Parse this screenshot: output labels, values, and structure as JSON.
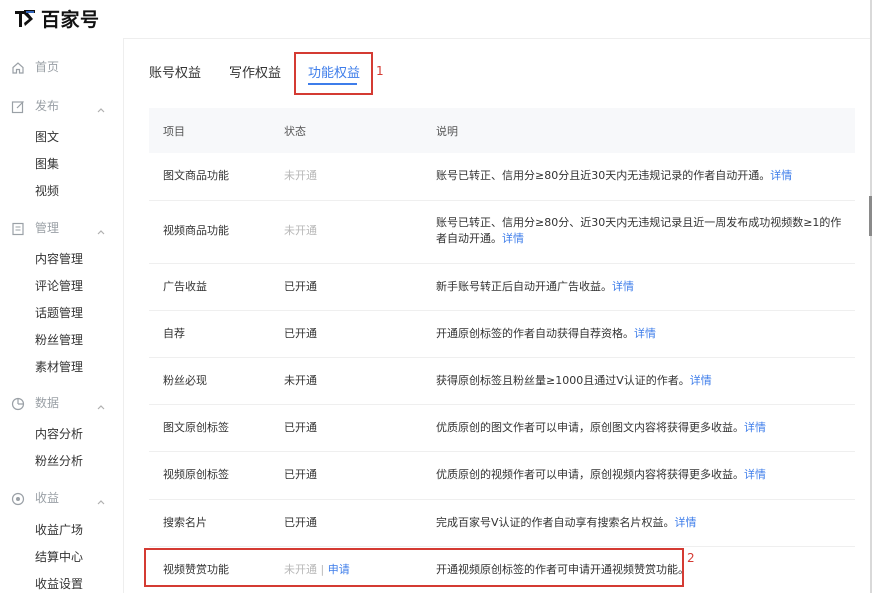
{
  "brand": {
    "name": "百家号"
  },
  "sidebar": {
    "home": "首页",
    "sections": [
      {
        "label": "发布",
        "items": [
          "图文",
          "图集",
          "视频"
        ]
      },
      {
        "label": "管理",
        "items": [
          "内容管理",
          "评论管理",
          "话题管理",
          "粉丝管理",
          "素材管理"
        ]
      },
      {
        "label": "数据",
        "items": [
          "内容分析",
          "粉丝分析"
        ]
      },
      {
        "label": "收益",
        "items": [
          "收益广场",
          "结算中心",
          "收益设置"
        ]
      }
    ]
  },
  "tabs": [
    {
      "label": "账号权益",
      "active": false
    },
    {
      "label": "写作权益",
      "active": false
    },
    {
      "label": "功能权益",
      "active": true
    }
  ],
  "table": {
    "headers": [
      "项目",
      "状态",
      "说明"
    ],
    "rows": [
      {
        "item": "图文商品功能",
        "status": "未开通",
        "enabled": false,
        "desc": "账号已转正、信用分≥80分且近30天内无违规记录的作者自动开通。",
        "link": "详情"
      },
      {
        "item": "视频商品功能",
        "status": "未开通",
        "enabled": false,
        "desc": "账号已转正、信用分≥80分、近30天内无违规记录且近一周发布成功视频数≥1的作者自动开通。",
        "link": "详情"
      },
      {
        "item": "广告收益",
        "status": "已开通",
        "enabled": true,
        "desc": "新手账号转正后自动开通广告收益。",
        "link": "详情"
      },
      {
        "item": "自荐",
        "status": "已开通",
        "enabled": true,
        "desc": "开通原创标签的作者自动获得自荐资格。",
        "link": "详情"
      },
      {
        "item": "粉丝必现",
        "status": "未开通",
        "enabled": true,
        "desc": "获得原创标签且粉丝量≥1000且通过V认证的作者。",
        "link": "详情"
      },
      {
        "item": "图文原创标签",
        "status": "已开通",
        "enabled": true,
        "desc": "优质原创的图文作者可以申请，原创图文内容将获得更多收益。",
        "link": "详情"
      },
      {
        "item": "视频原创标签",
        "status": "已开通",
        "enabled": true,
        "desc": "优质原创的视频作者可以申请，原创视频内容将获得更多收益。",
        "link": "详情"
      },
      {
        "item": "搜索名片",
        "status": "已开通",
        "enabled": true,
        "desc": "完成百家号V认证的作者自动享有搜索名片权益。",
        "link": "详情"
      },
      {
        "item": "视频赞赏功能",
        "status": "未开通",
        "enabled": false,
        "desc": "开通视频原创标签的作者可申请开通视频赞赏功能。",
        "link": "",
        "action_sep": "|",
        "action": "申请"
      }
    ]
  },
  "annotations": {
    "first": "1",
    "second": "2"
  },
  "colors": {
    "accent": "#3e7dea",
    "annotation": "#d43b33",
    "muted": "#b7b7b7"
  }
}
